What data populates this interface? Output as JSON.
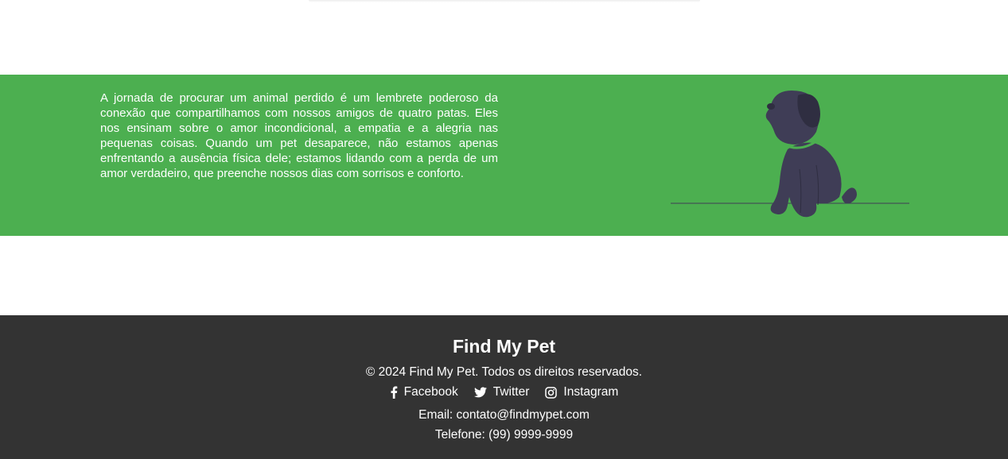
{
  "banner": {
    "text": "A jornada de procurar um animal perdido é um lembrete poderoso da conexão que compartilhamos com nossos amigos de quatro patas. Eles nos ensinam sobre o amor incondicional, a empatia e a alegria nas pequenas coisas. Quando um pet desaparece, não estamos apenas enfrentando a ausência física dele; estamos lidando com a perda de um amor verdadeiro, que preenche nossos dias com sorrisos e conforto.",
    "background_color": "#4caf50",
    "illustration_icon": "sitting-dog-illustration"
  },
  "footer": {
    "title": "Find My Pet",
    "copyright": "© 2024 Find My Pet. Todos os direitos reservados.",
    "social": [
      {
        "label": "Facebook",
        "icon": "facebook-icon"
      },
      {
        "label": "Twitter",
        "icon": "twitter-icon"
      },
      {
        "label": "Instagram",
        "icon": "instagram-icon"
      }
    ],
    "email": "Email: contato@findmypet.com",
    "phone": "Telefone: (99) 9999-9999",
    "background_color": "#333333"
  }
}
